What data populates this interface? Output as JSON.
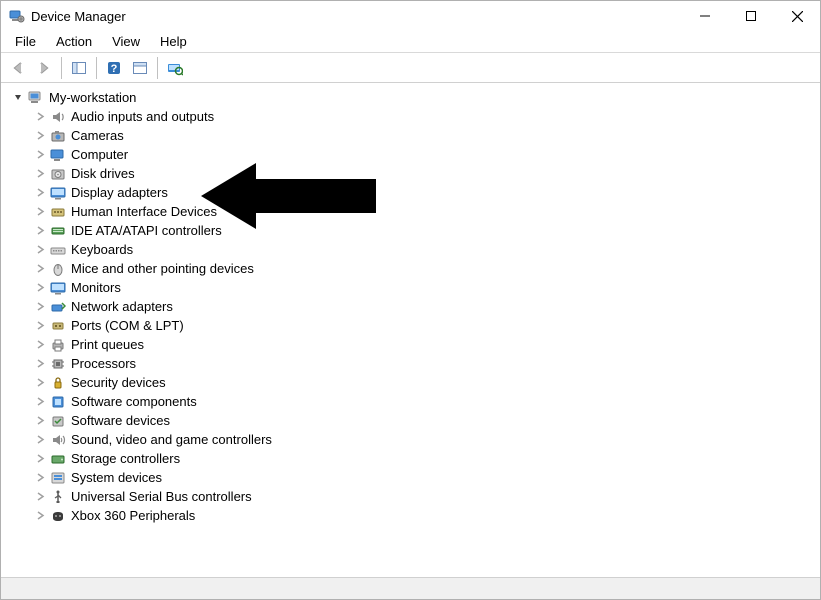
{
  "window": {
    "title": "Device Manager"
  },
  "menu": {
    "items": [
      "File",
      "Action",
      "View",
      "Help"
    ]
  },
  "tree": {
    "root": "My-workstation",
    "categories": [
      {
        "label": "Audio inputs and outputs",
        "icon": "audio"
      },
      {
        "label": "Cameras",
        "icon": "camera"
      },
      {
        "label": "Computer",
        "icon": "computer"
      },
      {
        "label": "Disk drives",
        "icon": "disk"
      },
      {
        "label": "Display adapters",
        "icon": "display"
      },
      {
        "label": "Human Interface Devices",
        "icon": "hid"
      },
      {
        "label": "IDE ATA/ATAPI controllers",
        "icon": "ide"
      },
      {
        "label": "Keyboards",
        "icon": "keyboard"
      },
      {
        "label": "Mice and other pointing devices",
        "icon": "mouse"
      },
      {
        "label": "Monitors",
        "icon": "monitor"
      },
      {
        "label": "Network adapters",
        "icon": "network"
      },
      {
        "label": "Ports (COM & LPT)",
        "icon": "port"
      },
      {
        "label": "Print queues",
        "icon": "printer"
      },
      {
        "label": "Processors",
        "icon": "cpu"
      },
      {
        "label": "Security devices",
        "icon": "security"
      },
      {
        "label": "Software components",
        "icon": "softcomp"
      },
      {
        "label": "Software devices",
        "icon": "softdev"
      },
      {
        "label": "Sound, video and game controllers",
        "icon": "sound"
      },
      {
        "label": "Storage controllers",
        "icon": "storage"
      },
      {
        "label": "System devices",
        "icon": "system"
      },
      {
        "label": "Universal Serial Bus controllers",
        "icon": "usb"
      },
      {
        "label": "Xbox 360 Peripherals",
        "icon": "xbox"
      }
    ]
  },
  "annotation": {
    "points_to": "Display adapters"
  }
}
